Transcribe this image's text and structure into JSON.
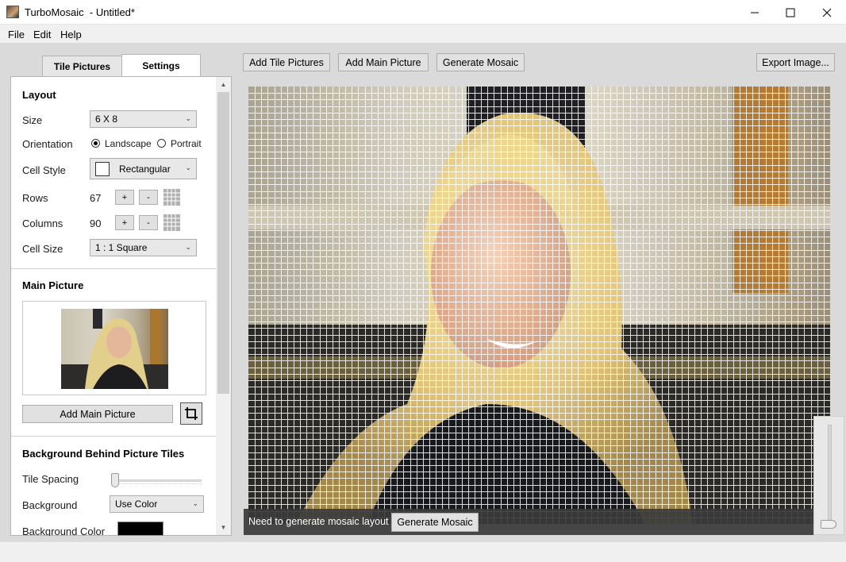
{
  "window": {
    "app_name": "TurboMosaic",
    "doc_title": "  - Untitled*",
    "minimize_glyph": "—",
    "maximize_glyph": "☐",
    "close_glyph": "✕"
  },
  "menu": [
    "File",
    "Edit",
    "Help"
  ],
  "tabs": {
    "tile": "Tile Pictures",
    "settings": "Settings"
  },
  "toolbar": {
    "add_tile": "Add Tile Pictures",
    "add_main": "Add Main Picture",
    "generate": "Generate Mosaic",
    "export": "Export Image..."
  },
  "layout": {
    "title": "Layout",
    "size_label": "Size",
    "size_value": "6 X 8",
    "orientation_label": "Orientation",
    "landscape": "Landscape",
    "portrait": "Portrait",
    "orientation_selected": "Landscape",
    "cell_style_label": "Cell Style",
    "cell_style_value": "Rectangular",
    "rows_label": "Rows",
    "rows_value": "67",
    "columns_label": "Columns",
    "columns_value": "90",
    "plus": "+",
    "minus": "-",
    "cell_size_label": "Cell Size",
    "cell_size_value": "1 : 1 Square"
  },
  "main_picture": {
    "title": "Main Picture",
    "add_button": "Add Main Picture",
    "crop_icon": "crop-icon"
  },
  "background": {
    "title": "Background Behind Picture Tiles",
    "spacing_label": "Tile Spacing",
    "spacing_level": 0,
    "background_label": "Background",
    "background_value": "Use Color",
    "color_label": "Background Color",
    "color_value": "#000000"
  },
  "status": {
    "message": "Need to generate mosaic layout",
    "button": "Generate Mosaic"
  },
  "mosaic_grid": {
    "columns": 90,
    "rows": 67
  },
  "colors": {
    "accent": "#e1e1e1",
    "grid_line": "#ffffff"
  }
}
